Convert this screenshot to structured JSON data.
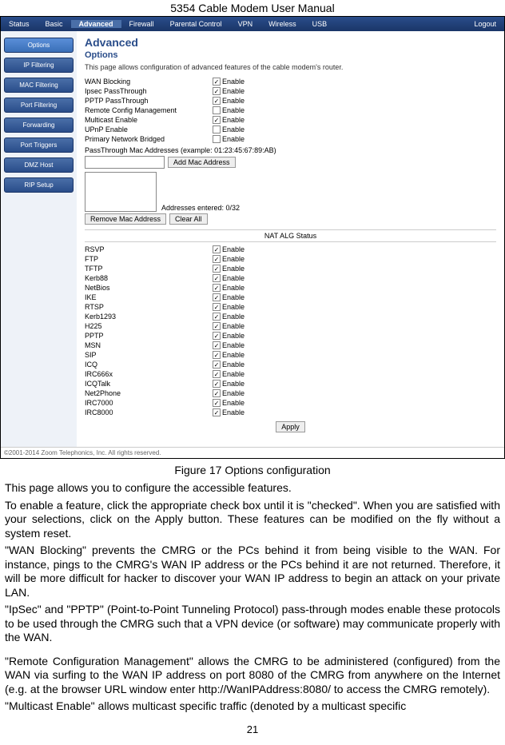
{
  "doc": {
    "header": "5354 Cable Modem User Manual",
    "page_number": "21"
  },
  "nav": {
    "items": [
      "Status",
      "Basic",
      "Advanced",
      "Firewall",
      "Parental Control",
      "VPN",
      "Wireless",
      "USB",
      "Logout"
    ],
    "active_index": 2
  },
  "sidebar": {
    "items": [
      "Options",
      "IP Filtering",
      "MAC Filtering",
      "Port Filtering",
      "Forwarding",
      "Port Triggers",
      "DMZ Host",
      "RIP Setup"
    ],
    "active_index": 0
  },
  "content": {
    "title": "Advanced",
    "subtitle": "Options",
    "description": "This page allows configuration of advanced features of the cable modem's router.",
    "enable_label": "Enable",
    "options": [
      {
        "label": "WAN Blocking",
        "checked": true
      },
      {
        "label": "Ipsec PassThrough",
        "checked": true
      },
      {
        "label": "PPTP PassThrough",
        "checked": true
      },
      {
        "label": "Remote Config Management",
        "checked": false
      },
      {
        "label": "Multicast Enable",
        "checked": true
      },
      {
        "label": "UPnP Enable",
        "checked": false
      },
      {
        "label": "Primary Network Bridged",
        "checked": false
      }
    ],
    "passthrough_label": "PassThrough Mac Addresses (example: 01:23:45:67:89:AB)",
    "add_mac_btn": "Add Mac Address",
    "addresses_entered": "Addresses entered: 0/32",
    "remove_mac_btn": "Remove Mac Address",
    "clear_all_btn": "Clear All",
    "nat_header": "NAT ALG Status",
    "nat_items": [
      {
        "label": "RSVP",
        "checked": true
      },
      {
        "label": "FTP",
        "checked": true
      },
      {
        "label": "TFTP",
        "checked": true
      },
      {
        "label": "Kerb88",
        "checked": true
      },
      {
        "label": "NetBios",
        "checked": true
      },
      {
        "label": "IKE",
        "checked": true
      },
      {
        "label": "RTSP",
        "checked": true
      },
      {
        "label": "Kerb1293",
        "checked": true
      },
      {
        "label": "H225",
        "checked": true
      },
      {
        "label": "PPTP",
        "checked": true
      },
      {
        "label": "MSN",
        "checked": true
      },
      {
        "label": "SIP",
        "checked": true
      },
      {
        "label": "ICQ",
        "checked": true
      },
      {
        "label": "IRC666x",
        "checked": true
      },
      {
        "label": "ICQTalk",
        "checked": true
      },
      {
        "label": "Net2Phone",
        "checked": true
      },
      {
        "label": "IRC7000",
        "checked": true
      },
      {
        "label": "IRC8000",
        "checked": true
      }
    ],
    "apply_btn": "Apply"
  },
  "footer": "©2001-2014 Zoom Telephonics, Inc. All rights reserved.",
  "caption": "Figure 17 Options configuration",
  "body": {
    "p1": "This page allows you to configure the accessible features.",
    "p2": "To enable a feature, click the appropriate check box until it is \"checked\".    When you are satisfied with your selections, click on the Apply button.    These features can be modified on the fly without a system reset.",
    "p3": "\"WAN Blocking\" prevents the CMRG or the PCs behind it from being visible to the WAN.    For instance, pings to the CMRG's WAN IP address or the PCs behind it are not returned.    Therefore, it will be more difficult for hacker to discover your WAN IP address to begin an attack on your private LAN.",
    "p4": "\"IpSec\" and \"PPTP\" (Point-to-Point Tunneling Protocol) pass-through modes enable these protocols to be used through the CMRG such that a VPN device (or software) may communicate properly with the WAN.",
    "p5": "\"Remote Configuration Management\" allows the CMRG to be administered (configured) from the WAN via surfing to the WAN IP address on port 8080 of the CMRG from anywhere on the Internet (e.g.  at the browser URL window enter http://WanIPAddress:8080/ to access the CMRG remotely).",
    "p6": "\"Multicast Enable\" allows multicast specific traffic (denoted by a multicast specific"
  }
}
